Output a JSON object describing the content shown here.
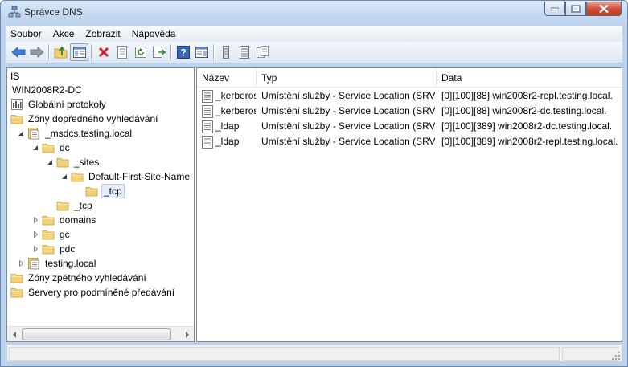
{
  "window": {
    "title": "Správce DNS"
  },
  "menu": [
    "Soubor",
    "Akce",
    "Zobrazit",
    "Nápověda"
  ],
  "toolbar": {
    "buttons": [
      "back-arrow-icon",
      "forward-arrow-icon",
      "up-folder-icon",
      "show-hide-tree-icon",
      "delete-icon",
      "properties-icon",
      "refresh-icon",
      "export-list-icon",
      "help-icon",
      "action-pane-icon",
      "server-icon",
      "zone-list-icon",
      "copy-records-icon"
    ]
  },
  "tree": {
    "root_label": "IS",
    "items": [
      {
        "label": "WIN2008R2-DC",
        "level": 0,
        "icon": "server",
        "arrow": "none"
      },
      {
        "label": "Globální protokoly",
        "level": 0,
        "icon": "log",
        "arrow": "none"
      },
      {
        "label": "Zóny dopředného vyhledávání",
        "level": 0,
        "icon": "folder",
        "arrow": "none"
      },
      {
        "label": "_msdcs.testing.local",
        "level": 1,
        "icon": "zone",
        "arrow": "expanded"
      },
      {
        "label": "dc",
        "level": 2,
        "icon": "folder",
        "arrow": "expanded"
      },
      {
        "label": "_sites",
        "level": 3,
        "icon": "folder",
        "arrow": "expanded"
      },
      {
        "label": "Default-First-Site-Name",
        "level": 4,
        "icon": "folder",
        "arrow": "expanded"
      },
      {
        "label": "_tcp",
        "level": 5,
        "icon": "folder",
        "arrow": "none",
        "selected": true
      },
      {
        "label": "_tcp",
        "level": 3,
        "icon": "folder",
        "arrow": "none"
      },
      {
        "label": "domains",
        "level": 2,
        "icon": "folder",
        "arrow": "collapsed"
      },
      {
        "label": "gc",
        "level": 2,
        "icon": "folder",
        "arrow": "collapsed"
      },
      {
        "label": "pdc",
        "level": 2,
        "icon": "folder",
        "arrow": "collapsed"
      },
      {
        "label": "testing.local",
        "level": 1,
        "icon": "zone",
        "arrow": "collapsed"
      },
      {
        "label": "Zóny zpětného vyhledávání",
        "level": 0,
        "icon": "folder",
        "arrow": "none"
      },
      {
        "label": "Servery pro podmíněné předávání",
        "level": 0,
        "icon": "folder",
        "arrow": "none"
      }
    ]
  },
  "list": {
    "columns": [
      "Název",
      "Typ",
      "Data"
    ],
    "rows": [
      {
        "name": "_kerberos",
        "type": "Umístění služby - Service Location (SRV)",
        "data": "[0][100][88] win2008r2-repl.testing.local."
      },
      {
        "name": "_kerberos",
        "type": "Umístění služby - Service Location (SRV)",
        "data": "[0][100][88] win2008r2-dc.testing.local."
      },
      {
        "name": "_ldap",
        "type": "Umístění služby - Service Location (SRV)",
        "data": "[0][100][389] win2008r2-dc.testing.local."
      },
      {
        "name": "_ldap",
        "type": "Umístění služby - Service Location (SRV)",
        "data": "[0][100][389] win2008r2-repl.testing.local."
      }
    ]
  },
  "colors": {
    "titlebar": "#c4d8f0",
    "folder": "#f3d27a",
    "selection": "#e4eefb"
  }
}
